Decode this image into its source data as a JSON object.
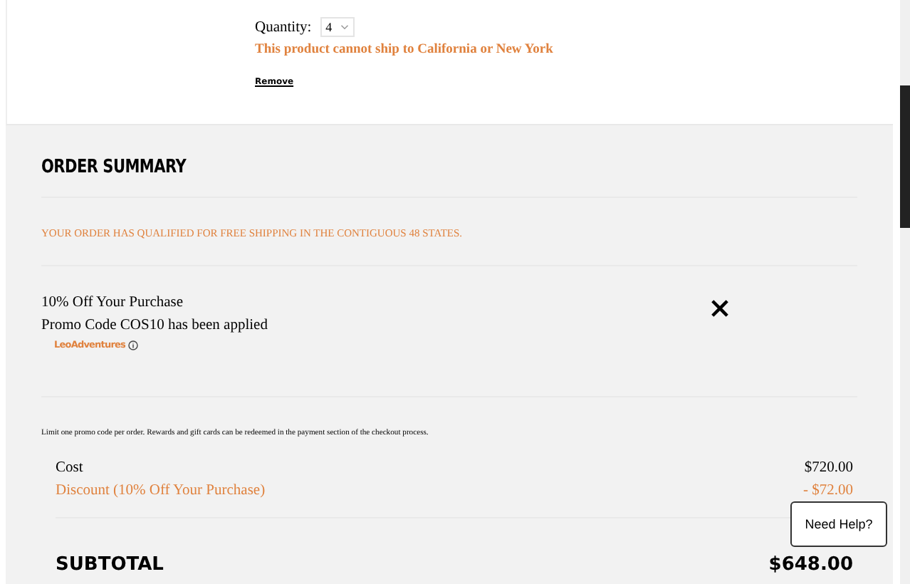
{
  "cart_item": {
    "quantity_label": "Quantity:",
    "quantity": "4",
    "shipping_warning": "This product cannot ship to California or New York",
    "remove_link": "Remove"
  },
  "order_summary": {
    "title": "ORDER SUMMARY",
    "free_shipping_notice": "YOUR ORDER HAS QUALIFIED FOR FREE SHIPPING IN THE CONTIGUOUS 48 STATES.",
    "promo": {
      "name": "10% Off Your Purchase",
      "status": "Promo Code COS10 has been applied",
      "source": "LeoAdventures"
    },
    "promo_note": "Limit one promo code per order. Rewards and gift cards can be redeemed in the payment section of the checkout process.",
    "lines": [
      {
        "kind": "cost",
        "label": "Cost",
        "amount": "$720.00"
      },
      {
        "kind": "discount",
        "label": "Discount (10% Off Your Purchase)",
        "amount": "- $72.00"
      }
    ],
    "subtotal": {
      "label": "SUBTOTAL",
      "amount": "$648.00"
    }
  },
  "help_button": "Need Help?"
}
